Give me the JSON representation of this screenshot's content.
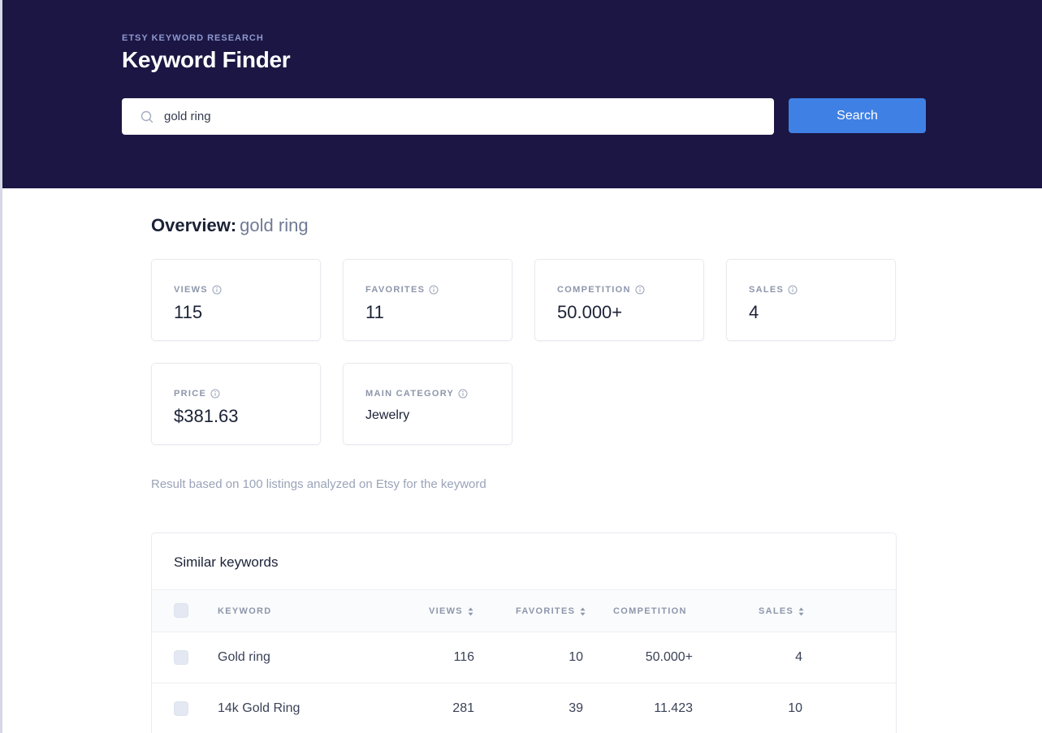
{
  "header": {
    "eyebrow": "ETSY KEYWORD RESEARCH",
    "title": "Keyword Finder",
    "search_value": "gold ring",
    "search_button": "Search"
  },
  "overview": {
    "label": "Overview:",
    "keyword": "gold ring"
  },
  "stats": [
    {
      "label": "VIEWS",
      "value": "115"
    },
    {
      "label": "FAVORITES",
      "value": "11"
    },
    {
      "label": "COMPETITION",
      "value": "50.000+"
    },
    {
      "label": "SALES",
      "value": "4"
    },
    {
      "label": "PRICE",
      "value": "$381.63"
    },
    {
      "label": "MAIN CATEGORY",
      "value": "Jewelry"
    }
  ],
  "note": "Result based on 100 listings analyzed on Etsy for the keyword",
  "similar": {
    "title": "Similar keywords",
    "columns": [
      "KEYWORD",
      "VIEWS",
      "FAVORITES",
      "COMPETITION",
      "SALES"
    ],
    "rows": [
      {
        "keyword": "Gold ring",
        "views": "116",
        "favorites": "10",
        "competition": "50.000+",
        "sales": "4"
      },
      {
        "keyword": "14k Gold Ring",
        "views": "281",
        "favorites": "39",
        "competition": "11.423",
        "sales": "10"
      }
    ]
  },
  "colors": {
    "hero_bg": "#1b1643",
    "accent": "#3f80e4"
  }
}
